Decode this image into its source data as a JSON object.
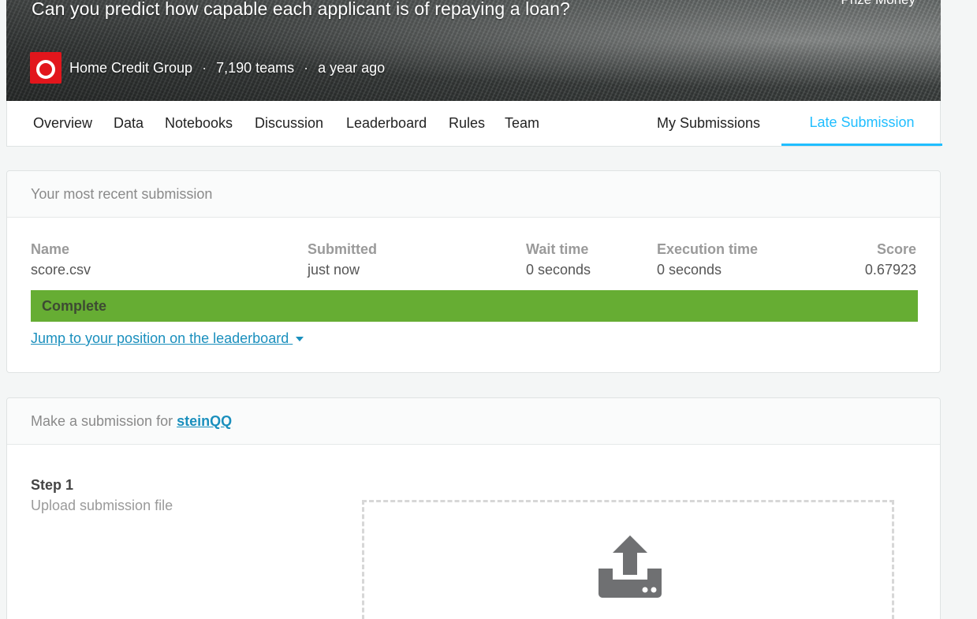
{
  "banner": {
    "title": "Can you predict how capable each applicant is of repaying a loan?",
    "prize_label": "Prize Money",
    "host": "Home Credit Group",
    "teams": "7,190 teams",
    "age": "a year ago",
    "sep": "·",
    "logo_color": "#e2161c"
  },
  "tabs": {
    "overview": "Overview",
    "data": "Data",
    "notebooks": "Notebooks",
    "discussion": "Discussion",
    "leaderboard": "Leaderboard",
    "rules": "Rules",
    "team": "Team",
    "my_submissions": "My Submissions",
    "late_submission": "Late Submission",
    "active_color": "#20beff"
  },
  "recent": {
    "header": "Your most recent submission",
    "columns": {
      "name": "Name",
      "submitted": "Submitted",
      "wait": "Wait time",
      "exec": "Execution time",
      "score": "Score"
    },
    "row": {
      "name": "score.csv",
      "submitted": "just now",
      "wait": "0 seconds",
      "exec": "0 seconds",
      "score": "0.67923"
    },
    "status": "Complete",
    "status_color": "#66ad33",
    "jump_link": "Jump to your position on the leaderboard"
  },
  "make": {
    "header_prefix": "Make a submission for",
    "team_link": "steinQQ",
    "step_title": "Step 1",
    "step_desc": "Upload submission file"
  }
}
